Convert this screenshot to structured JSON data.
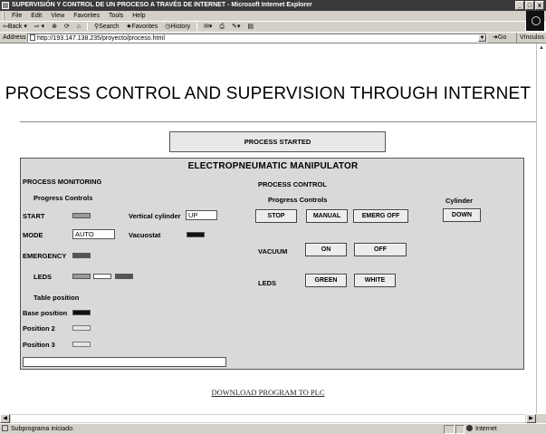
{
  "window": {
    "title": "SUPERVISIÓN Y CONTROL DE UN PROCESO A TRAVÉS DE INTERNET - Microsoft Internet Explorer",
    "controls": [
      "_",
      "□",
      "x"
    ]
  },
  "menu": [
    "File",
    "Edit",
    "View",
    "Favorites",
    "Tools",
    "Help"
  ],
  "toolbar": {
    "back": "⇦Back",
    "forward": "⇨",
    "search": "Search",
    "favorites": "Favorites",
    "history": "History"
  },
  "address": {
    "label": "Address",
    "url": "http://193.147.138.235/proyecto/proceso.html",
    "go": "Go",
    "links": "Vínculos"
  },
  "page": {
    "title": "PROCESS CONTROL AND SUPERVISION THROUGH INTERNET",
    "status_banner": "PROCESS STARTED",
    "panel_heading": "ELECTROPNEUMATIC MANIPULATOR",
    "monitoring": {
      "heading": "PROCESS MONITORING",
      "progress_controls": "Progress Controls",
      "start": "START",
      "vertical_cylinder_label": "Vertical cylinder",
      "vertical_cylinder_value": "UP",
      "mode_label": "MODE",
      "mode_value": "AUTO",
      "vacuostat_label": "Vacuostat",
      "emergency": "EMERGENCY",
      "leds": "LEDS",
      "table_position": "Table position",
      "base_position": "Base position",
      "position_2": "Position 2",
      "position_3": "Position 3",
      "message_value": ""
    },
    "control": {
      "heading": "PROCESS CONTROL",
      "progress_controls": "Progress Controls",
      "cylinder": "Cylinder",
      "stop": "STOP",
      "manual": "MANUAL",
      "emerg_off": "EMERG OFF",
      "down": "DOWN",
      "vacuum": "VACUUM",
      "on": "ON",
      "off": "OFF",
      "leds": "LEDS",
      "green": "GREEN",
      "white": "WHITE"
    },
    "download_link": "DOWNLOAD PROGRAM TO PLC"
  },
  "status": {
    "text": "Subprograma iniciado.",
    "zone": "Internet"
  }
}
